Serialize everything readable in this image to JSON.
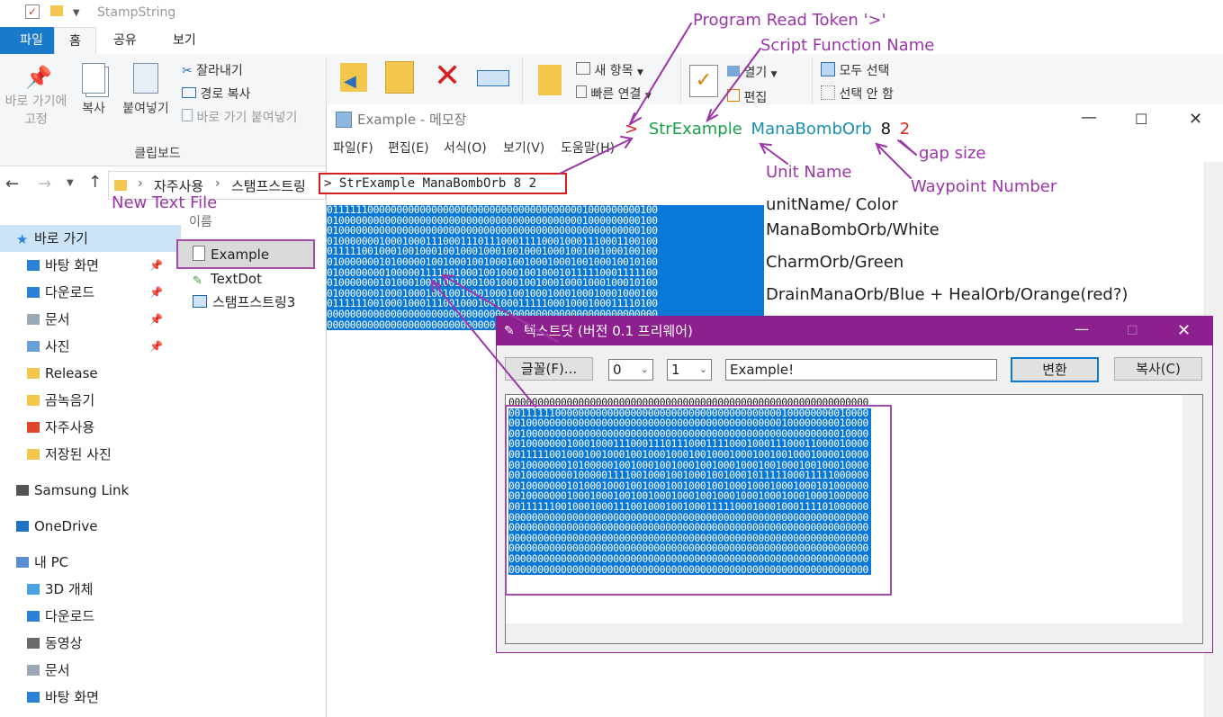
{
  "explorer": {
    "title": "StampString",
    "tabs": [
      "파일",
      "홈",
      "공유",
      "보기"
    ],
    "ribbon": {
      "pin_label_1": "바로 가기에",
      "pin_label_2": "고정",
      "copy_label": "복사",
      "paste_label": "붙여넣기",
      "cut_label": "잘라내기",
      "copy_path_label": "경로 복사",
      "paste_shortcut_label": "바로 가기 붙여넣기",
      "clipboard_group": "클립보드",
      "new_item_label": "새 항목",
      "quick_access_label": "빠른 연결",
      "open_label": "열기",
      "edit_label": "편집",
      "select_all_label": "모두 선택",
      "select_none_label": "선택 안 함"
    },
    "breadcrumb": [
      "자주사용",
      "스탬프스트링"
    ],
    "name_column": "이름",
    "files": [
      "Example",
      "TextDot",
      "스탬프스트링3"
    ],
    "nav": [
      {
        "label": "바로 가기",
        "icon": "star-icon",
        "pinned": false,
        "indent": 0
      },
      {
        "label": "바탕 화면",
        "icon": "desktop-folder-icon",
        "pinned": true,
        "indent": 1
      },
      {
        "label": "다운로드",
        "icon": "download-folder-icon",
        "pinned": true,
        "indent": 1
      },
      {
        "label": "문서",
        "icon": "document-folder-icon",
        "pinned": true,
        "indent": 1
      },
      {
        "label": "사진",
        "icon": "picture-folder-icon",
        "pinned": true,
        "indent": 1
      },
      {
        "label": "Release",
        "icon": "folder-icon",
        "pinned": false,
        "indent": 1
      },
      {
        "label": "곰녹음기",
        "icon": "folder-icon",
        "pinned": false,
        "indent": 1
      },
      {
        "label": "자주사용",
        "icon": "red-app-icon",
        "pinned": false,
        "indent": 1
      },
      {
        "label": "저장된 사진",
        "icon": "folder-icon",
        "pinned": false,
        "indent": 1
      },
      {
        "label": "Samsung Link",
        "icon": "samsung-link-icon",
        "pinned": false,
        "indent": 0
      },
      {
        "label": "OneDrive",
        "icon": "cloud-icon",
        "pinned": false,
        "indent": 0
      },
      {
        "label": "내 PC",
        "icon": "computer-icon",
        "pinned": false,
        "indent": 0
      },
      {
        "label": "3D 개체",
        "icon": "3d-folder-icon",
        "pinned": false,
        "indent": 1
      },
      {
        "label": "다운로드",
        "icon": "download-folder-icon",
        "pinned": false,
        "indent": 1
      },
      {
        "label": "동영상",
        "icon": "video-folder-icon",
        "pinned": false,
        "indent": 1
      },
      {
        "label": "문서",
        "icon": "document-folder-icon",
        "pinned": false,
        "indent": 1
      },
      {
        "label": "바탕 화면",
        "icon": "desktop-folder-icon",
        "pinned": false,
        "indent": 1
      }
    ]
  },
  "notepad": {
    "title": "Example - 메모장",
    "menu": [
      "파일(F)",
      "편집(E)",
      "서식(O)",
      "보기(V)",
      "도움말(H)"
    ],
    "command_line": "> StrExample ManaBombOrb 8 2",
    "token": ">",
    "func_name": "StrExample",
    "unit_name": "ManaBombOrb",
    "waypoint": "8",
    "gap": "2",
    "binary_lines": [
      "011111100000000000000000000000000000000000001000000000100",
      "010000000000000000000000000000000000000000001000000000100",
      "010000000000000000000000000000000000000000000000000000100",
      "010000000100010001110001110111000111100010001110001100100",
      "011111001000100100010010001000100100010001001001000100100",
      "010000000101000001001000100100010010001000100100010010100",
      "010000000010000011110010001001000100100010111110001111100",
      "010000000101000100010010001001000100100010001000100010100",
      "010000000100010001001001000100010010001000100010001000100",
      "011111100100010001110010001001000111110001000100011110100",
      "000000000000000000000000000000000000000000000000000000000",
      "000000000000000000000000000000000000000000000000000000000"
    ]
  },
  "textdot": {
    "title": "텍스트닷 (버전 0.1 프리웨어)",
    "font_button": "글꼴(F)...",
    "select1": "0",
    "select2": "1",
    "input_value": "Example!",
    "convert_button": "변환",
    "copy_button": "복사(C)",
    "output_lines": [
      "00000000000000000000000000000000000000000000000000000000000000",
      "00111111000000000000000000000000000000000000000100000000010000",
      "00100000000000000000000000000000000000000000000100000000010000",
      "00100000000000000000000000000000000000000000000000000000010000",
      "00100000001000100011100011101110001111000100011100011000010000",
      "00111110010001001000100100010001001000100010010010001000010000",
      "00100000001010000010010001001000100100010001001000100100010000",
      "00100000000100000111100100010010001001000101111100011111000000",
      "00100000001010001000100100010010001001000100010001000101000000",
      "00100000001000100010010010001000100100010001000100010001000000",
      "00111111001000100011100100010010001111100010001000111101000000",
      "00000000000000000000000000000000000000000000000000000000000000",
      "00000000000000000000000000000000000000000000000000000000000000",
      "00000000000000000000000000000000000000000000000000000000000000",
      "00000000000000000000000000000000000000000000000000000000000000",
      "00000000000000000000000000000000000000000000000000000000000000",
      "00000000000000000000000000000000000000000000000000000000000000"
    ]
  },
  "annotations": {
    "program_read_token": "Program Read Token '>'",
    "script_function_name": "Script Function Name",
    "unit_name": "Unit Name",
    "gap_size": "gap size",
    "waypoint_number": "Waypoint Number",
    "new_text_file": "New Text File",
    "colors_header": "unitName/ Color",
    "color_1": "ManaBombOrb/White",
    "color_2": "CharmOrb/Green",
    "color_3": "DrainManaOrb/Blue + HealOrb/Orange(red?)"
  },
  "colors": {
    "annotation": "#9b36a8",
    "highlight_red": "#e02020",
    "func_green": "#18a24a",
    "unit_teal": "#1a8fb0",
    "selection_blue": "#0a78d7",
    "explorer_blue": "#1979ca",
    "textdot_purple": "#8e1f8e"
  }
}
